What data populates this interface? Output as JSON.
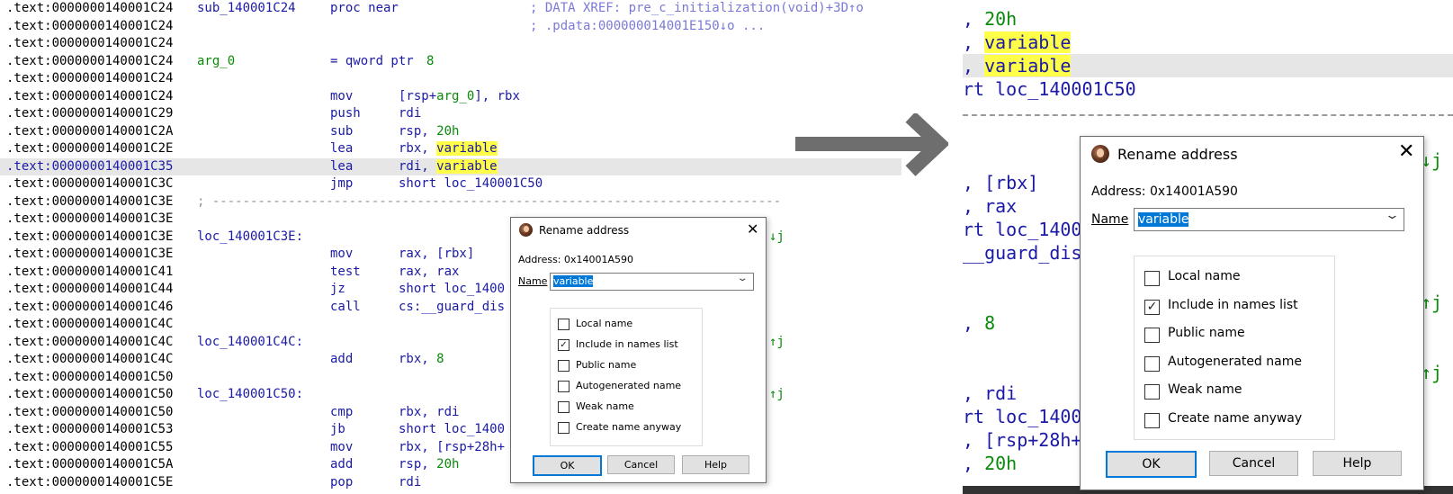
{
  "left_listing": {
    "rows": [
      {
        "addr": ".text:0000000140001C24",
        "label": "sub_140001C24",
        "mnem": "proc near",
        "comment": "; DATA XREF: pre_c_initialization(void)+3D↑o"
      },
      {
        "addr": ".text:0000000140001C24",
        "comment": "; .pdata:000000014001E150↓o ..."
      },
      {
        "addr": ".text:0000000140001C24"
      },
      {
        "addr": ".text:0000000140001C24",
        "label": "arg_0",
        "label_green": true,
        "mnem": "= qword ptr",
        "op_num": "8"
      },
      {
        "addr": ".text:0000000140001C24"
      },
      {
        "addr": ".text:0000000140001C24",
        "mnem": "mov",
        "op_pre": "[rsp+",
        "op_green": "arg_0",
        "op_post": "], rbx"
      },
      {
        "addr": ".text:0000000140001C29",
        "mnem": "push",
        "op": "rdi"
      },
      {
        "addr": ".text:0000000140001C2A",
        "mnem": "sub",
        "op": "rsp, ",
        "op_num": "20h"
      },
      {
        "addr": ".text:0000000140001C2E",
        "mnem": "lea",
        "op": "rbx, ",
        "op_hl": "variable"
      },
      {
        "addr": ".text:0000000140001C35",
        "mnem": "lea",
        "op": "rdi, ",
        "op_hl": "variable",
        "selected": true
      },
      {
        "addr": ".text:0000000140001C3C",
        "mnem": "jmp",
        "op": "short loc_140001C50"
      },
      {
        "addr": ".text:0000000140001C3E",
        "separator": "; ---------------------------------------------------------------------------"
      },
      {
        "addr": ".text:0000000140001C3E"
      },
      {
        "addr": ".text:0000000140001C3E",
        "label": "loc_140001C3E:",
        "xref": "↓j"
      },
      {
        "addr": ".text:0000000140001C3E",
        "mnem": "mov",
        "op": "rax, [rbx]"
      },
      {
        "addr": ".text:0000000140001C41",
        "mnem": "test",
        "op": "rax, rax"
      },
      {
        "addr": ".text:0000000140001C44",
        "mnem": "jz",
        "op": "short loc_1400"
      },
      {
        "addr": ".text:0000000140001C46",
        "mnem": "call",
        "op": "cs:__guard_dis"
      },
      {
        "addr": ".text:0000000140001C4C"
      },
      {
        "addr": ".text:0000000140001C4C",
        "label": "loc_140001C4C:",
        "xref": "↑j"
      },
      {
        "addr": ".text:0000000140001C4C",
        "mnem": "add",
        "op": "rbx, ",
        "op_num": "8"
      },
      {
        "addr": ".text:0000000140001C50"
      },
      {
        "addr": ".text:0000000140001C50",
        "label": "loc_140001C50:",
        "xref": "↑j"
      },
      {
        "addr": ".text:0000000140001C50",
        "mnem": "cmp",
        "op": "rbx, rdi"
      },
      {
        "addr": ".text:0000000140001C53",
        "mnem": "jb",
        "op": "short loc_1400"
      },
      {
        "addr": ".text:0000000140001C55",
        "mnem": "mov",
        "op": "rbx, [rsp+28h+"
      },
      {
        "addr": ".text:0000000140001C5A",
        "mnem": "add",
        "op": "rsp, ",
        "op_num": "20h"
      },
      {
        "addr": ".text:0000000140001C5E",
        "mnem": "pop",
        "op": "rdi"
      }
    ]
  },
  "right_zoom": {
    "rows": [
      {
        "pre": ", ",
        "num": "20h"
      },
      {
        "pre": ", ",
        "hl": "variable"
      },
      {
        "pre": ", ",
        "hl": "variable",
        "selected": true
      },
      {
        "pre": "rt loc_140001C50"
      },
      {
        "pre": ""
      },
      {
        "pre": ""
      },
      {
        "pre": ""
      },
      {
        "pre": ", [rbx]"
      },
      {
        "pre": ", rax"
      },
      {
        "pre": "rt loc_1400"
      },
      {
        "pre": "__guard_dis"
      },
      {
        "pre": ""
      },
      {
        "pre": ""
      },
      {
        "pre": ", ",
        "num": "8"
      },
      {
        "pre": ""
      },
      {
        "pre": ""
      },
      {
        "pre": ", rdi"
      },
      {
        "pre": "rt loc_1400"
      },
      {
        "pre": ", [rsp+28h+"
      },
      {
        "pre": ", ",
        "num": "20h"
      }
    ],
    "side_marks": [
      "↓j",
      "↑j",
      "↑j"
    ]
  },
  "dialog": {
    "title": "Rename address",
    "address_label": "Address:",
    "address_value": "0x14001A590",
    "name_label": "Name",
    "name_value": "variable",
    "options": [
      {
        "label": "Local name",
        "checked": false
      },
      {
        "label": "Include in names list",
        "checked": true
      },
      {
        "label": "Public name",
        "checked": false
      },
      {
        "label": "Autogenerated name",
        "checked": false
      },
      {
        "label": "Weak name",
        "checked": false
      },
      {
        "label": "Create name anyway",
        "checked": false
      }
    ],
    "buttons": {
      "ok": "OK",
      "cancel": "Cancel",
      "help": "Help"
    },
    "close_icon": "close-icon",
    "app_icon": "ida-app-icon"
  },
  "colors": {
    "mnemonic_blue": "#1a1aa6",
    "number_green": "#0a8a0a",
    "highlight_yellow": "#ffff4a",
    "selected_row": "#e6e6e6",
    "selection_blue": "#0078d7",
    "arrow_gray": "#6e6e6e"
  }
}
